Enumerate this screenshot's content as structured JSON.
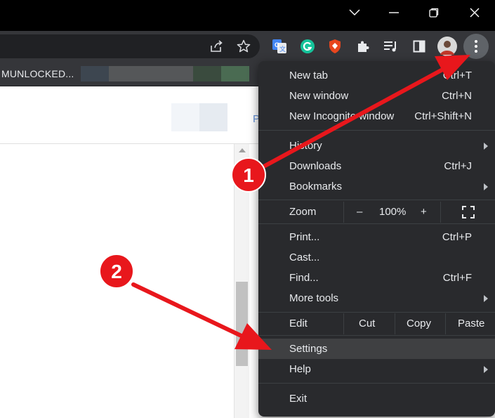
{
  "bookmarks": {
    "first_label": "MUNLOCKED..."
  },
  "page": {
    "partial_text": "P"
  },
  "menu": {
    "items": [
      {
        "label": "New tab",
        "shortcut": "Ctrl+T"
      },
      {
        "label": "New window",
        "shortcut": "Ctrl+N"
      },
      {
        "label": "New Incognito window",
        "shortcut": "Ctrl+Shift+N"
      },
      {
        "label": "History",
        "shortcut": ""
      },
      {
        "label": "Downloads",
        "shortcut": "Ctrl+J"
      },
      {
        "label": "Bookmarks",
        "shortcut": ""
      },
      {
        "label": "Print...",
        "shortcut": "Ctrl+P"
      },
      {
        "label": "Cast...",
        "shortcut": ""
      },
      {
        "label": "Find...",
        "shortcut": "Ctrl+F"
      },
      {
        "label": "More tools",
        "shortcut": ""
      },
      {
        "label": "Settings",
        "shortcut": ""
      },
      {
        "label": "Help",
        "shortcut": ""
      },
      {
        "label": "Exit",
        "shortcut": ""
      }
    ],
    "zoom": {
      "label": "Zoom",
      "minus": "–",
      "value": "100%",
      "plus": "+"
    },
    "edit": {
      "label": "Edit",
      "cut": "Cut",
      "copy": "Copy",
      "paste": "Paste"
    }
  },
  "annotations": {
    "step1": "1",
    "step2": "2"
  },
  "colors": {
    "annotation_red": "#e8171c",
    "menu_bg": "#292a2d",
    "toolbar_bg": "#35363a",
    "highlight": "#3f4042"
  }
}
